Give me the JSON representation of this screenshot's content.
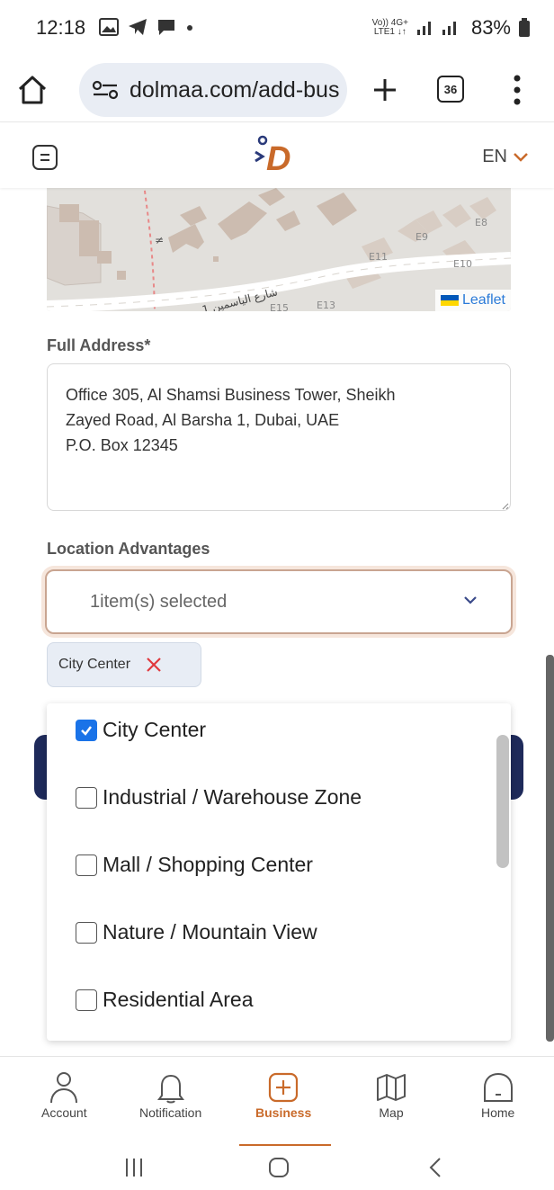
{
  "status_bar": {
    "time": "12:18",
    "network_top": "Vo)) 4G+",
    "network_bottom": "LTE1 ↓↑",
    "battery": "83%"
  },
  "browser": {
    "url": "dolmaa.com/add-bus",
    "tabs_count": "36"
  },
  "header": {
    "logo_text": "D",
    "language": "EN"
  },
  "map": {
    "labels": [
      "E9",
      "E8",
      "E11",
      "E10",
      "E13",
      "E15",
      "شارع الياسمين 1"
    ],
    "attribution": "Leaflet"
  },
  "form": {
    "full_address_label": "Full Address*",
    "full_address_value": "Office 305, Al Shamsi Business Tower, Sheikh\nZayed Road, Al Barsha 1, Dubai, UAE\nP.O. Box 12345",
    "location_advantages_label": "Location Advantages",
    "select_value": "1item(s) selected",
    "selected_chip": "City Center"
  },
  "dropdown_options": [
    {
      "label": "City Center",
      "checked": true
    },
    {
      "label": "Industrial / Warehouse Zone",
      "checked": false
    },
    {
      "label": "Mall / Shopping Center",
      "checked": false
    },
    {
      "label": "Nature / Mountain View",
      "checked": false
    },
    {
      "label": "Residential Area",
      "checked": false
    }
  ],
  "bottom_nav": {
    "account": "Account",
    "notification": "Notification",
    "business": "Business",
    "map": "Map",
    "home": "Home"
  },
  "colors": {
    "accent": "#c96a2a",
    "checkbox": "#1a73e8",
    "button_dark": "#1e2a5a"
  }
}
